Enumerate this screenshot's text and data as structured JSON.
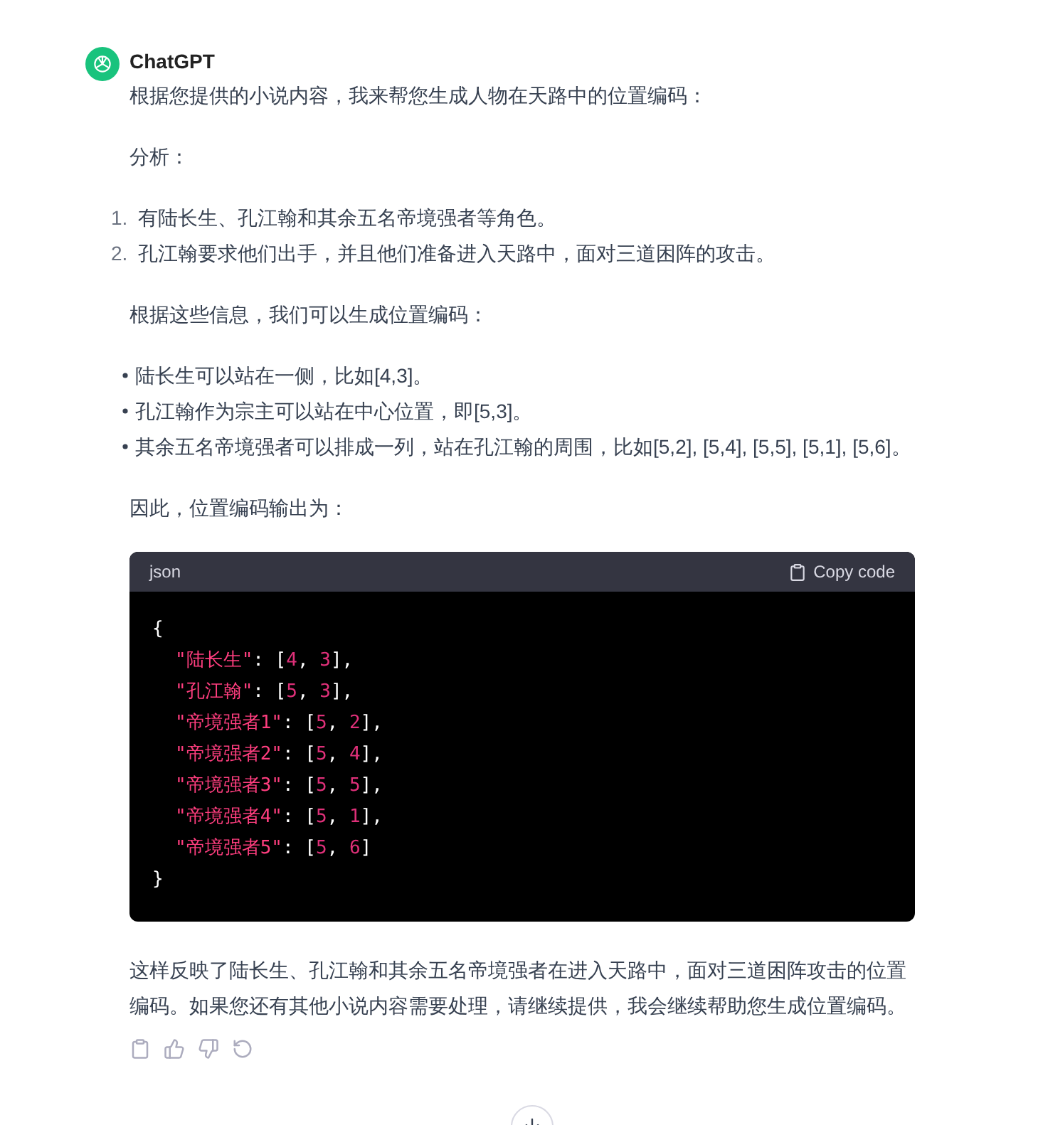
{
  "message": {
    "author": "ChatGPT",
    "intro": "根据您提供的小说内容，我来帮您生成人物在天路中的位置编码：",
    "analysis_label": "分析：",
    "numbered": [
      {
        "number": "1.",
        "text": "有陆长生、孔江翰和其余五名帝境强者等角色。"
      },
      {
        "number": "2.",
        "text": "孔江翰要求他们出手，并且他们准备进入天路中，面对三道困阵的攻击。"
      }
    ],
    "lead": "根据这些信息，我们可以生成位置编码：",
    "bullets": [
      "陆长生可以站在一侧，比如[4,3]。",
      "孔江翰作为宗主可以站在中心位置，即[5,3]。",
      "其余五名帝境强者可以排成一列，站在孔江翰的周围，比如[5,2], [5,4], [5,5], [5,1], [5,6]。"
    ],
    "output_label": "因此，位置编码输出为：",
    "code": {
      "language": "json",
      "copy_label": "Copy code",
      "lines": [
        [
          {
            "kind": "punct",
            "t": "{"
          }
        ],
        [
          {
            "kind": "string",
            "t": "\"陆长生\""
          },
          {
            "kind": "punct",
            "t": ": ["
          },
          {
            "kind": "number",
            "t": "4"
          },
          {
            "kind": "punct",
            "t": ", "
          },
          {
            "kind": "number",
            "t": "3"
          },
          {
            "kind": "punct",
            "t": "],"
          }
        ],
        [
          {
            "kind": "string",
            "t": "\"孔江翰\""
          },
          {
            "kind": "punct",
            "t": ": ["
          },
          {
            "kind": "number",
            "t": "5"
          },
          {
            "kind": "punct",
            "t": ", "
          },
          {
            "kind": "number",
            "t": "3"
          },
          {
            "kind": "punct",
            "t": "],"
          }
        ],
        [
          {
            "kind": "string",
            "t": "\"帝境强者1\""
          },
          {
            "kind": "punct",
            "t": ": ["
          },
          {
            "kind": "number",
            "t": "5"
          },
          {
            "kind": "punct",
            "t": ", "
          },
          {
            "kind": "number",
            "t": "2"
          },
          {
            "kind": "punct",
            "t": "],"
          }
        ],
        [
          {
            "kind": "string",
            "t": "\"帝境强者2\""
          },
          {
            "kind": "punct",
            "t": ": ["
          },
          {
            "kind": "number",
            "t": "5"
          },
          {
            "kind": "punct",
            "t": ", "
          },
          {
            "kind": "number",
            "t": "4"
          },
          {
            "kind": "punct",
            "t": "],"
          }
        ],
        [
          {
            "kind": "string",
            "t": "\"帝境强者3\""
          },
          {
            "kind": "punct",
            "t": ": ["
          },
          {
            "kind": "number",
            "t": "5"
          },
          {
            "kind": "punct",
            "t": ", "
          },
          {
            "kind": "number",
            "t": "5"
          },
          {
            "kind": "punct",
            "t": "],"
          }
        ],
        [
          {
            "kind": "string",
            "t": "\"帝境强者4\""
          },
          {
            "kind": "punct",
            "t": ": ["
          },
          {
            "kind": "number",
            "t": "5"
          },
          {
            "kind": "punct",
            "t": ", "
          },
          {
            "kind": "number",
            "t": "1"
          },
          {
            "kind": "punct",
            "t": "],"
          }
        ],
        [
          {
            "kind": "string",
            "t": "\"帝境强者5\""
          },
          {
            "kind": "punct",
            "t": ": ["
          },
          {
            "kind": "number",
            "t": "5"
          },
          {
            "kind": "punct",
            "t": ", "
          },
          {
            "kind": "number",
            "t": "6"
          },
          {
            "kind": "punct",
            "t": "]"
          }
        ],
        [
          {
            "kind": "punct",
            "t": "}"
          }
        ]
      ]
    },
    "closing": "这样反映了陆长生、孔江翰和其余五名帝境强者在进入天路中，面对三道困阵攻击的位置编码。如果您还有其他小说内容需要处理，请继续提供，我会继续帮助您生成位置编码。"
  }
}
